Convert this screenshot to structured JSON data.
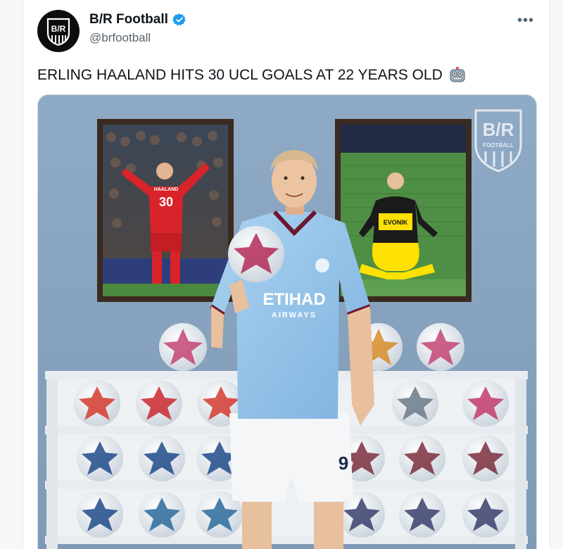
{
  "tweet": {
    "author_name": "B/R Football",
    "author_handle": "@brfootball",
    "avatar_text": "B/R",
    "more_label": "•••",
    "text": "ERLING HAALAND HITS 30 UCL GOALS AT 22 YEARS OLD",
    "emoji": "robot-face-icon",
    "verified": true
  },
  "image": {
    "watermark": "B/R",
    "watermark_sub": "FOOTBALL",
    "left_frame_shirt_name": "HAALAND",
    "left_frame_shirt_number": "30",
    "right_frame_sponsor": "EVONIK",
    "main_shirt_sponsor": "ETIHAD",
    "main_shirt_sponsor_sub": "AIRWAYS",
    "shorts_number": "9"
  },
  "colors": {
    "verified_blue": "#1d9bf0",
    "man_city_blue": "#98c5e9",
    "salzburg_red": "#d8232a",
    "dortmund_yellow": "#fde100",
    "background_blue": "#8aa6c1"
  }
}
